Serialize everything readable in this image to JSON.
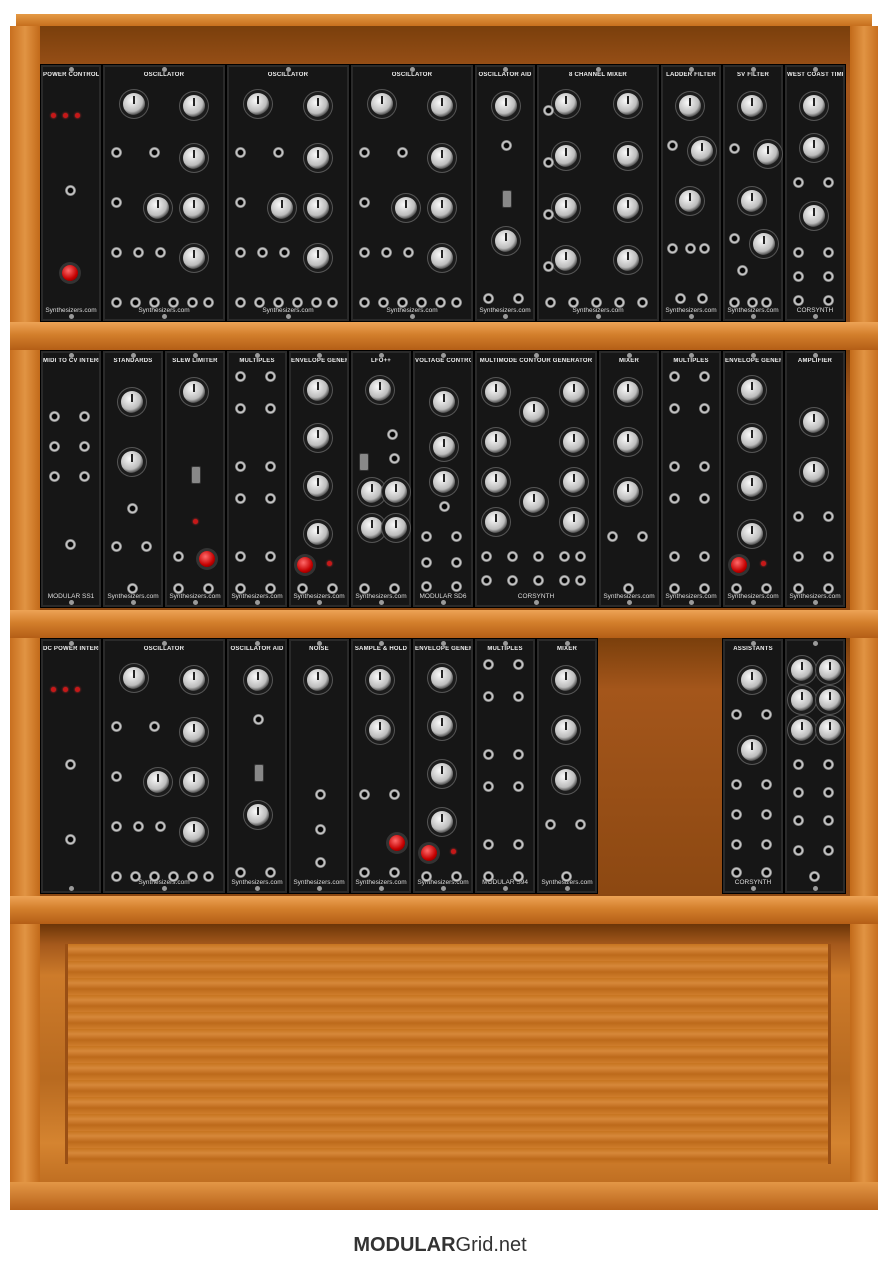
{
  "footer": {
    "brand_bold": "MODULAR",
    "brand_rest": "Grid.net"
  },
  "rows": [
    {
      "modules": [
        {
          "title": "POWER CONTROL",
          "brand": "Synthesizers.com"
        },
        {
          "title": "OSCILLATOR",
          "brand": "Synthesizers.com"
        },
        {
          "title": "OSCILLATOR",
          "brand": "Synthesizers.com"
        },
        {
          "title": "OSCILLATOR",
          "brand": "Synthesizers.com"
        },
        {
          "title": "OSCILLATOR AID",
          "brand": "Synthesizers.com"
        },
        {
          "title": "8 CHANNEL MIXER",
          "brand": "Synthesizers.com"
        },
        {
          "title": "LADDER FILTER",
          "brand": "Synthesizers.com"
        },
        {
          "title": "SV FILTER",
          "brand": "Synthesizers.com"
        },
        {
          "title": "WEST COAST TIMBRE",
          "brand": "CORSYNTH"
        }
      ]
    },
    {
      "modules": [
        {
          "title": "MIDI TO CV INTERFACE",
          "brand": "MODULAR SS1"
        },
        {
          "title": "STANDARDS",
          "brand": "Synthesizers.com"
        },
        {
          "title": "SLEW LIMITER",
          "brand": "Synthesizers.com"
        },
        {
          "title": "MULTIPLES",
          "brand": "Synthesizers.com"
        },
        {
          "title": "ENVELOPE GENERATOR",
          "brand": "Synthesizers.com"
        },
        {
          "title": "LFO++",
          "brand": "Synthesizers.com"
        },
        {
          "title": "VOLTAGE CONTROLLED AMPLIFIER",
          "brand": "MODULAR SD6"
        },
        {
          "title": "MULTIMODE CONTOUR GENERATOR",
          "brand": "CORSYNTH"
        },
        {
          "title": "MIXER",
          "brand": "Synthesizers.com"
        },
        {
          "title": "MULTIPLES",
          "brand": "Synthesizers.com"
        },
        {
          "title": "ENVELOPE GENERATOR",
          "brand": "Synthesizers.com"
        },
        {
          "title": "AMPLIFIER",
          "brand": "Synthesizers.com"
        }
      ]
    },
    {
      "modules": [
        {
          "title": "DC POWER INTERFACE",
          "brand": ""
        },
        {
          "title": "OSCILLATOR",
          "brand": "Synthesizers.com"
        },
        {
          "title": "OSCILLATOR AID",
          "brand": "Synthesizers.com"
        },
        {
          "title": "NOISE",
          "brand": "Synthesizers.com"
        },
        {
          "title": "SAMPLE & HOLD",
          "brand": "Synthesizers.com"
        },
        {
          "title": "ENVELOPE GENERATOR",
          "brand": "Synthesizers.com"
        },
        {
          "title": "MULTIPLES",
          "brand": "MODULAR S94"
        },
        {
          "title": "MIXER",
          "brand": "Synthesizers.com"
        },
        {
          "title": "ASSISTANTS",
          "brand": "CORSYNTH"
        },
        {
          "title": "",
          "brand": ""
        }
      ]
    }
  ]
}
